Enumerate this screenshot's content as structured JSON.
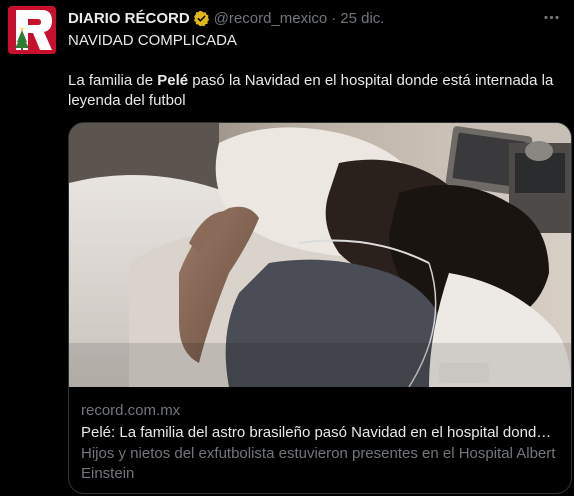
{
  "tweet": {
    "author_name": "DIARIO RÉCORD",
    "handle": "@record_mexico",
    "separator": "·",
    "date": "25 dic.",
    "more_icon": "ellipsis-icon",
    "verified_icon": "verified-gold-badge-icon",
    "verified_color": "#e2b719",
    "avatar_logo_letter": "R",
    "avatar_color": "#c8102e",
    "line1": "NAVIDAD COMPLICADA",
    "line2_pre": "La familia de ",
    "line2_bold": "Pelé",
    "line2_post": " pasó la Navidad en el hospital donde está internada la leyenda del futbol"
  },
  "card": {
    "domain": "record.com.mx",
    "title": "Pelé: La familia del astro brasileño pasó Navidad en el hospital donde ...",
    "description": "Hijos y nietos del exfutbolista estuvieron presentes en el Hospital Albert Einstein"
  },
  "colors": {
    "background": "#000000",
    "text_primary": "#e7e9ea",
    "text_secondary": "#71767b",
    "border": "#2f3336"
  }
}
